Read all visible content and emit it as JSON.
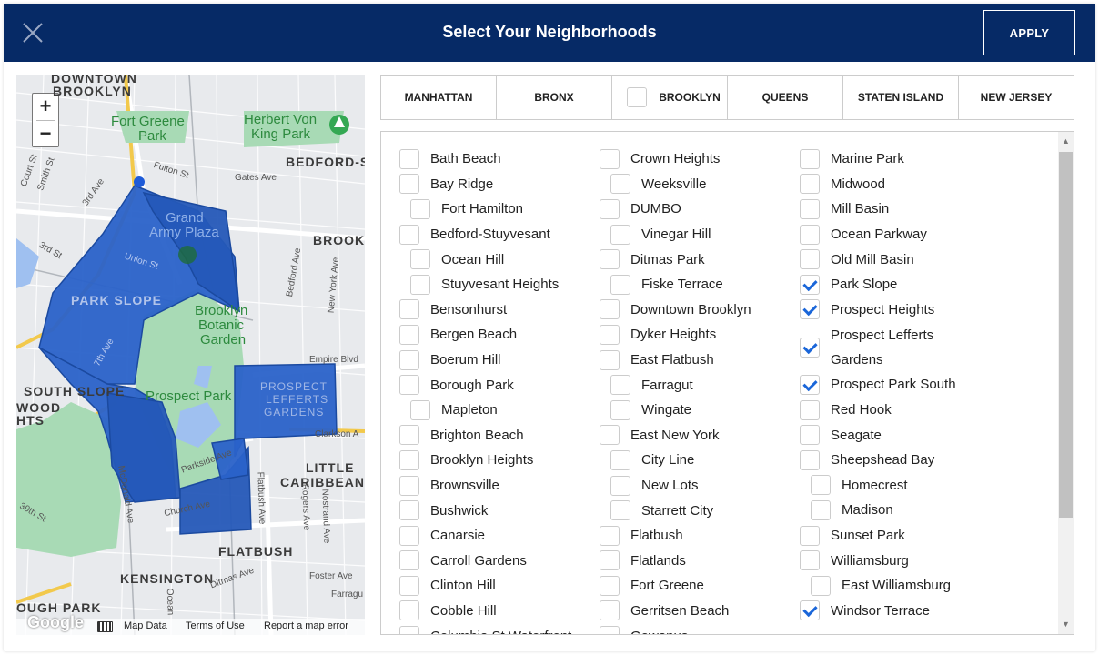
{
  "header": {
    "title": "Select Your Neighborhoods",
    "apply_label": "APPLY"
  },
  "map": {
    "area_labels": [
      "DOWNTOWN",
      "BROOKLYN",
      "BEDFORD-S",
      "BROOK",
      "PARK SLOPE",
      "SOUTH SLOPE",
      "WOOD",
      "HTS",
      "LITTLE",
      "CARIBBEAN",
      "FLATBUSH",
      "KENSINGTON",
      "OUGH PARK"
    ],
    "park_labels": [
      "Fort Greene",
      "Park",
      "Herbert Von",
      "King Park",
      "Grand",
      "Army Plaza",
      "Brooklyn",
      "Botanic",
      "Garden",
      "Prospect Park"
    ],
    "street_labels": [
      "Fulton St",
      "Gates Ave",
      "3rd Ave",
      "Union St",
      "Bedford Ave",
      "New York Ave",
      "Empire Blvd",
      "Clarkson A",
      "Parkside Ave",
      "Church Ave",
      "Flatbush Ave",
      "Rogers Ave",
      "Nostrand Ave",
      "Ocean",
      "Ditmas Ave",
      "Foster Ave",
      "Farragu",
      "McDonald Ave",
      "7th Ave",
      "Court St",
      "Smith St",
      "3rd St",
      "39th St"
    ],
    "hood_labels": [
      "PROSPECT",
      "LEFFERTS",
      "GARDENS"
    ],
    "zoom_in": "+",
    "zoom_out": "−",
    "footer": {
      "google": "Google",
      "map_data": "Map Data",
      "terms": "Terms of Use",
      "report": "Report a map error"
    }
  },
  "boroughs": [
    {
      "label": "MANHATTAN",
      "checkbox": false
    },
    {
      "label": "BRONX",
      "checkbox": false
    },
    {
      "label": "BROOKLYN",
      "checkbox": true
    },
    {
      "label": "QUEENS",
      "checkbox": false
    },
    {
      "label": "STATEN ISLAND",
      "checkbox": false
    },
    {
      "label": "NEW JERSEY",
      "checkbox": false
    }
  ],
  "columns": [
    [
      {
        "label": "Bath Beach",
        "checked": false,
        "sub": false
      },
      {
        "label": "Bay Ridge",
        "checked": false,
        "sub": false
      },
      {
        "label": "Fort Hamilton",
        "checked": false,
        "sub": true
      },
      {
        "label": "Bedford-Stuyvesant",
        "checked": false,
        "sub": false
      },
      {
        "label": "Ocean Hill",
        "checked": false,
        "sub": true
      },
      {
        "label": "Stuyvesant Heights",
        "checked": false,
        "sub": true
      },
      {
        "label": "Bensonhurst",
        "checked": false,
        "sub": false
      },
      {
        "label": "Bergen Beach",
        "checked": false,
        "sub": false
      },
      {
        "label": "Boerum Hill",
        "checked": false,
        "sub": false
      },
      {
        "label": "Borough Park",
        "checked": false,
        "sub": false
      },
      {
        "label": "Mapleton",
        "checked": false,
        "sub": true
      },
      {
        "label": "Brighton Beach",
        "checked": false,
        "sub": false
      },
      {
        "label": "Brooklyn Heights",
        "checked": false,
        "sub": false
      },
      {
        "label": "Brownsville",
        "checked": false,
        "sub": false
      },
      {
        "label": "Bushwick",
        "checked": false,
        "sub": false
      },
      {
        "label": "Canarsie",
        "checked": false,
        "sub": false
      },
      {
        "label": "Carroll Gardens",
        "checked": false,
        "sub": false
      },
      {
        "label": "Clinton Hill",
        "checked": false,
        "sub": false
      },
      {
        "label": "Cobble Hill",
        "checked": false,
        "sub": false
      },
      {
        "label": "Columbia St Waterfront",
        "checked": false,
        "sub": false
      }
    ],
    [
      {
        "label": "Crown Heights",
        "checked": false,
        "sub": false
      },
      {
        "label": "Weeksville",
        "checked": false,
        "sub": true
      },
      {
        "label": "DUMBO",
        "checked": false,
        "sub": false
      },
      {
        "label": "Vinegar Hill",
        "checked": false,
        "sub": true
      },
      {
        "label": "Ditmas Park",
        "checked": false,
        "sub": false
      },
      {
        "label": "Fiske Terrace",
        "checked": false,
        "sub": true
      },
      {
        "label": "Downtown Brooklyn",
        "checked": false,
        "sub": false
      },
      {
        "label": "Dyker Heights",
        "checked": false,
        "sub": false
      },
      {
        "label": "East Flatbush",
        "checked": false,
        "sub": false
      },
      {
        "label": "Farragut",
        "checked": false,
        "sub": true
      },
      {
        "label": "Wingate",
        "checked": false,
        "sub": true
      },
      {
        "label": "East New York",
        "checked": false,
        "sub": false
      },
      {
        "label": "City Line",
        "checked": false,
        "sub": true
      },
      {
        "label": "New Lots",
        "checked": false,
        "sub": true
      },
      {
        "label": "Starrett City",
        "checked": false,
        "sub": true
      },
      {
        "label": "Flatbush",
        "checked": false,
        "sub": false
      },
      {
        "label": "Flatlands",
        "checked": false,
        "sub": false
      },
      {
        "label": "Fort Greene",
        "checked": false,
        "sub": false
      },
      {
        "label": "Gerritsen Beach",
        "checked": false,
        "sub": false
      },
      {
        "label": "Gowanus",
        "checked": false,
        "sub": false
      }
    ],
    [
      {
        "label": "Marine Park",
        "checked": false,
        "sub": false
      },
      {
        "label": "Midwood",
        "checked": false,
        "sub": false
      },
      {
        "label": "Mill Basin",
        "checked": false,
        "sub": false
      },
      {
        "label": "Ocean Parkway",
        "checked": false,
        "sub": false
      },
      {
        "label": "Old Mill Basin",
        "checked": false,
        "sub": false
      },
      {
        "label": "Park Slope",
        "checked": true,
        "sub": false
      },
      {
        "label": "Prospect Heights",
        "checked": true,
        "sub": false
      },
      {
        "label": "Prospect Lefferts Gardens",
        "checked": true,
        "sub": false,
        "tall": true
      },
      {
        "label": "Prospect Park South",
        "checked": true,
        "sub": false
      },
      {
        "label": "Red Hook",
        "checked": false,
        "sub": false
      },
      {
        "label": "Seagate",
        "checked": false,
        "sub": false
      },
      {
        "label": "Sheepshead Bay",
        "checked": false,
        "sub": false
      },
      {
        "label": "Homecrest",
        "checked": false,
        "sub": true
      },
      {
        "label": "Madison",
        "checked": false,
        "sub": true
      },
      {
        "label": "Sunset Park",
        "checked": false,
        "sub": false
      },
      {
        "label": "Williamsburg",
        "checked": false,
        "sub": false
      },
      {
        "label": "East Williamsburg",
        "checked": false,
        "sub": true
      },
      {
        "label": "Windsor Terrace",
        "checked": true,
        "sub": false
      }
    ]
  ],
  "colors": {
    "header_bg": "#062a66",
    "selection_fill": "#2a62c9",
    "check": "#1a66d9"
  }
}
